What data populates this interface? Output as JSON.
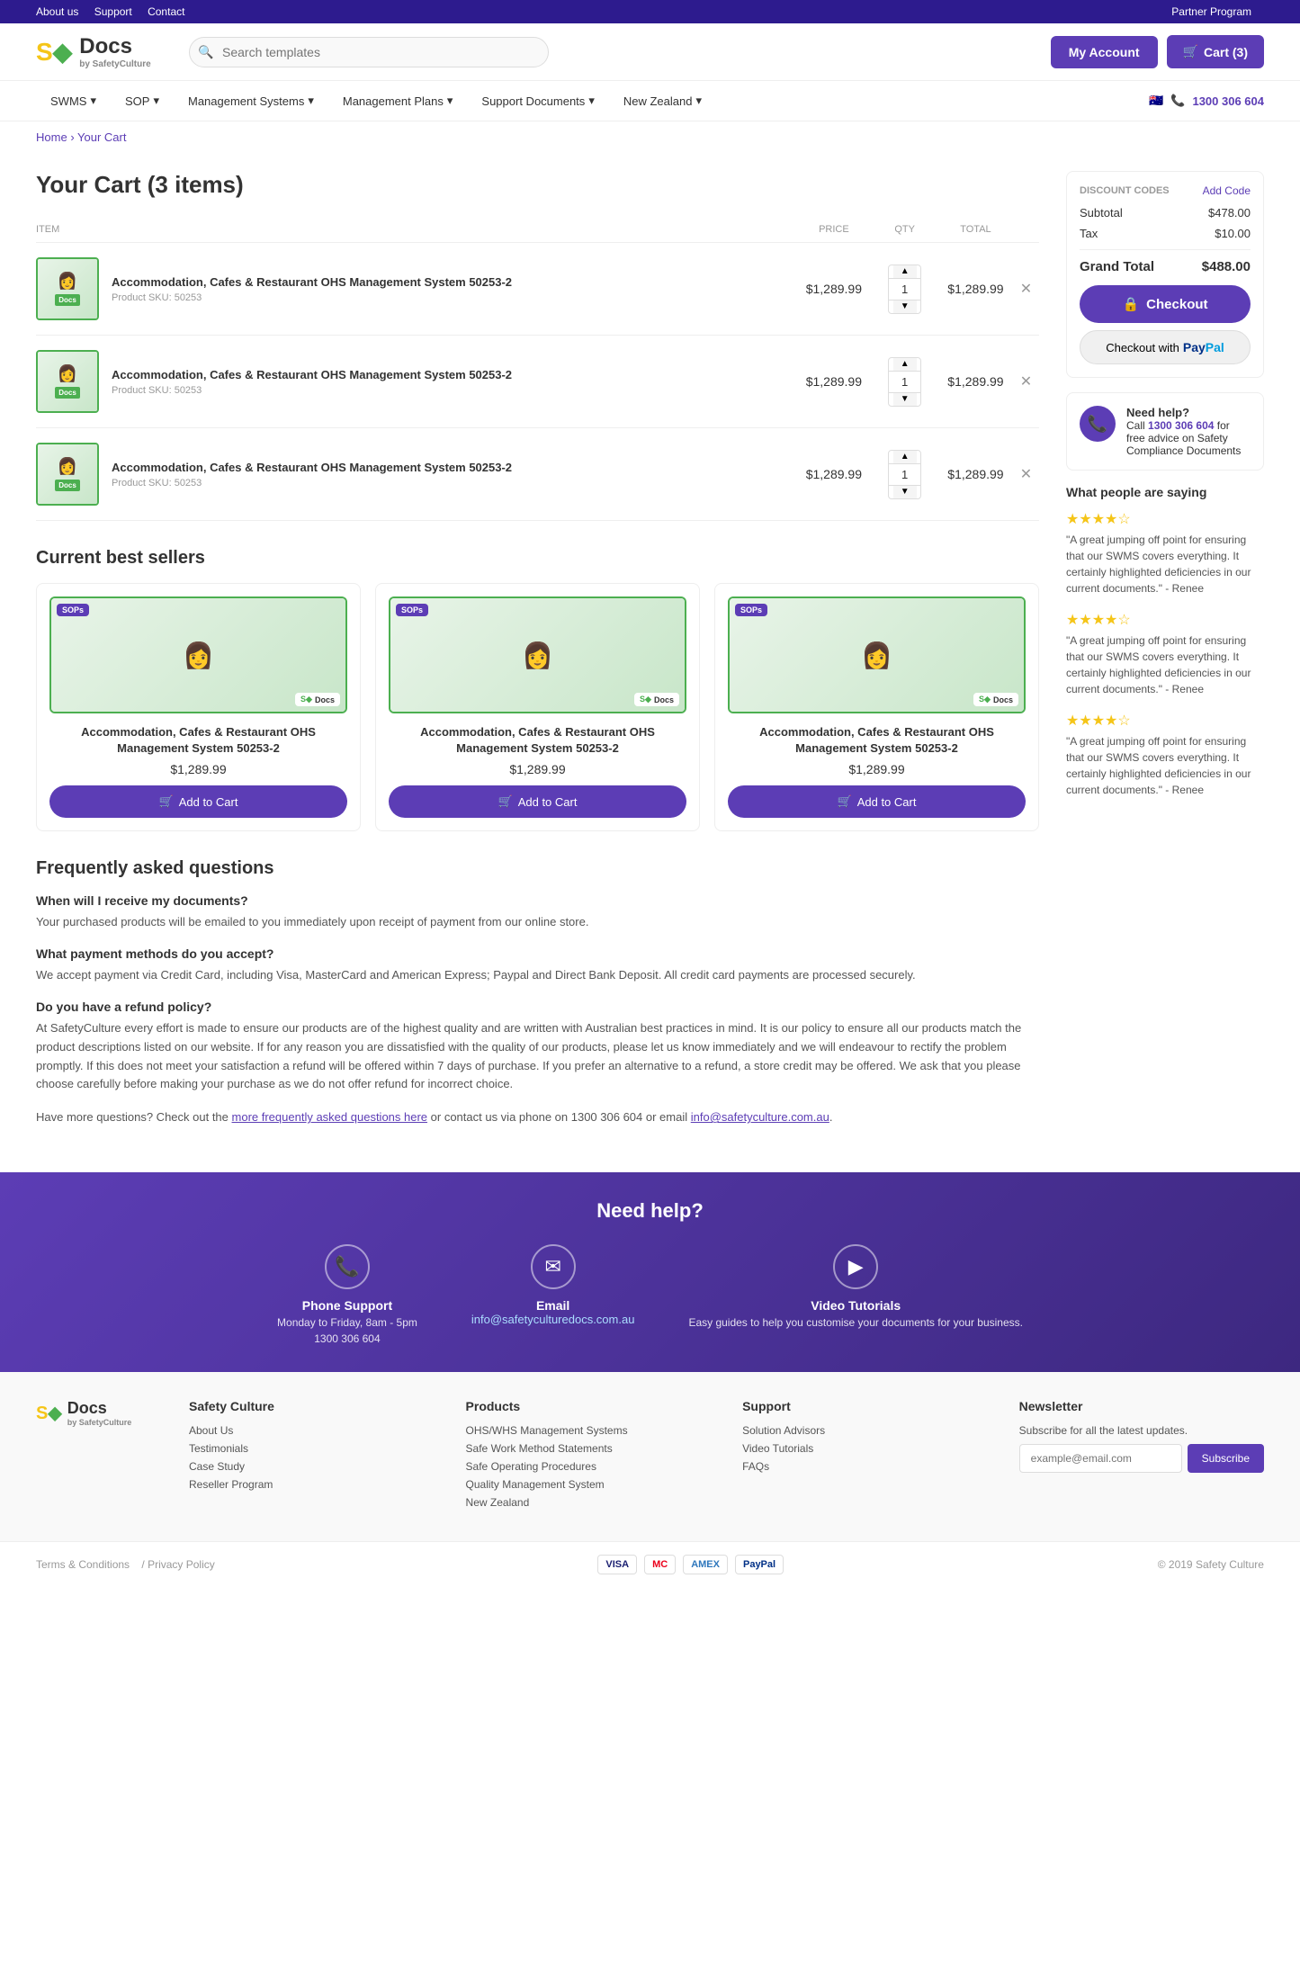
{
  "topbar": {
    "links": [
      "About us",
      "Support",
      "Contact"
    ],
    "right": "Partner Program"
  },
  "header": {
    "logo": "Docs",
    "logo_sub": "by SafetyCulture",
    "search_placeholder": "Search templates",
    "my_account": "My Account",
    "cart_label": "Cart (3)"
  },
  "nav": {
    "items": [
      {
        "label": "SWMS",
        "has_arrow": true
      },
      {
        "label": "SOP",
        "has_arrow": true
      },
      {
        "label": "Management Systems",
        "has_arrow": true
      },
      {
        "label": "Management Plans",
        "has_arrow": true
      },
      {
        "label": "Support Documents",
        "has_arrow": true
      },
      {
        "label": "New Zealand",
        "has_arrow": true
      }
    ],
    "phone": "1300 306 604"
  },
  "breadcrumb": {
    "home": "Home",
    "current": "Your Cart"
  },
  "cart": {
    "title": "Your Cart (3 items)",
    "columns": {
      "item": "ITEM",
      "price": "PRICE",
      "qty": "QTY",
      "total": "TOTAL"
    },
    "items": [
      {
        "name": "Accommodation, Cafes & Restaurant OHS Management System 50253-2",
        "sku": "Product SKU: 50253",
        "price": "$1,289.99",
        "qty": 1,
        "total": "$1,289.99"
      },
      {
        "name": "Accommodation, Cafes & Restaurant OHS Management System 50253-2",
        "sku": "Product SKU: 50253",
        "price": "$1,289.99",
        "qty": 1,
        "total": "$1,289.99"
      },
      {
        "name": "Accommodation, Cafes & Restaurant OHS Management System 50253-2",
        "sku": "Product SKU: 50253",
        "price": "$1,289.99",
        "qty": 1,
        "total": "$1,289.99"
      }
    ]
  },
  "sidebar": {
    "discount_codes": "DISCOUNT CODES",
    "add_code": "Add Code",
    "subtotal_label": "Subtotal",
    "subtotal": "$478.00",
    "tax_label": "Tax",
    "tax": "$10.00",
    "grand_total_label": "Grand Total",
    "grand_total": "$488.00",
    "checkout": "Checkout",
    "checkout_paypal": "Checkout with",
    "need_help_title": "Need help?",
    "need_help_text": "Call 1300 306 604 for free advice on Safety Compliance Documents",
    "phone": "1300 306 604"
  },
  "reviews": {
    "title": "What people are saying",
    "items": [
      {
        "stars": 4,
        "text": "\"A great jumping off point for ensuring that our SWMS covers everything. It certainly highlighted deficiencies in our current documents.\" - Renee"
      },
      {
        "stars": 4,
        "text": "\"A great jumping off point for ensuring that our SWMS covers everything. It certainly highlighted deficiencies in our current documents.\" - Renee"
      },
      {
        "stars": 4,
        "text": "\"A great jumping off point for ensuring that our SWMS covers everything. It certainly highlighted deficiencies in our current documents.\" - Renee"
      }
    ]
  },
  "best_sellers": {
    "title": "Current best sellers",
    "products": [
      {
        "name": "Accommodation, Cafes & Restaurant OHS Management System 50253-2",
        "price": "$1,289.99",
        "add_to_cart": "Add to Cart"
      },
      {
        "name": "Accommodation, Cafes & Restaurant OHS Management System 50253-2",
        "price": "$1,289.99",
        "add_to_cart": "Add to Cart"
      },
      {
        "name": "Accommodation, Cafes & Restaurant OHS Management System 50253-2",
        "price": "$1,289.99",
        "add_to_cart": "Add to Cart"
      }
    ]
  },
  "faq": {
    "title": "Frequently asked questions",
    "items": [
      {
        "q": "When will I receive my documents?",
        "a": "Your purchased products will be emailed to you immediately upon receipt of payment from our online store."
      },
      {
        "q": "What payment methods do you accept?",
        "a": "We accept payment via Credit Card, including Visa, MasterCard and American Express; Paypal and Direct Bank Deposit. All credit card payments are processed securely."
      },
      {
        "q": "Do you have a refund policy?",
        "a": "At SafetyCulture every effort is made to ensure our products are of the highest quality and are written with Australian best practices in mind. It is our policy to ensure all our products match the product descriptions listed on our website. If for any reason you are dissatisfied with the quality of our products, please let us know immediately and we will endeavour to rectify the problem promptly. If this does not meet your satisfaction a refund will be offered within 7 days of purchase. If you prefer an alternative to a refund, a store credit may be offered. We ask that you please choose carefully before making your purchase as we do not offer refund for incorrect choice."
      }
    ],
    "more_questions": "Have more questions? Check out the",
    "faq_link_text": "more frequently asked questions here",
    "contact_text": "or contact us via phone on 1300 306 604 or email",
    "email_link": "info@safetyculture.com.au"
  },
  "help_banner": {
    "title": "Need help?",
    "phone": {
      "title": "Phone Support",
      "sub": "Monday to Friday, 8am - 5pm",
      "value": "1300 306 604"
    },
    "email": {
      "title": "Email",
      "value": "info@safetyculturedocs.com.au"
    },
    "video": {
      "title": "Video Tutorials",
      "sub": "Easy guides to help you customise your documents for your business."
    }
  },
  "footer": {
    "logo": "Docs",
    "logo_sub": "by SafetyCulture",
    "columns": [
      {
        "title": "Safety Culture",
        "links": [
          "About Us",
          "Testimonials",
          "Case Study",
          "Reseller Program"
        ]
      },
      {
        "title": "Products",
        "links": [
          "OHS/WHS Management Systems",
          "Safe Work Method Statements",
          "Safe Operating Procedures",
          "Quality Management System",
          "New Zealand"
        ]
      },
      {
        "title": "Support",
        "links": [
          "Solution Advisors",
          "Video Tutorials",
          "FAQs"
        ]
      },
      {
        "title": "Newsletter",
        "sub": "Subscribe for all the latest updates.",
        "placeholder": "example@email.com",
        "subscribe": "Subscribe"
      }
    ],
    "bottom": {
      "terms": "Terms & Conditions",
      "privacy": "Privacy Policy",
      "copyright": "© 2019 Safety Culture",
      "payments": [
        "VISA",
        "MC",
        "AMEX",
        "PayPal"
      ]
    }
  }
}
